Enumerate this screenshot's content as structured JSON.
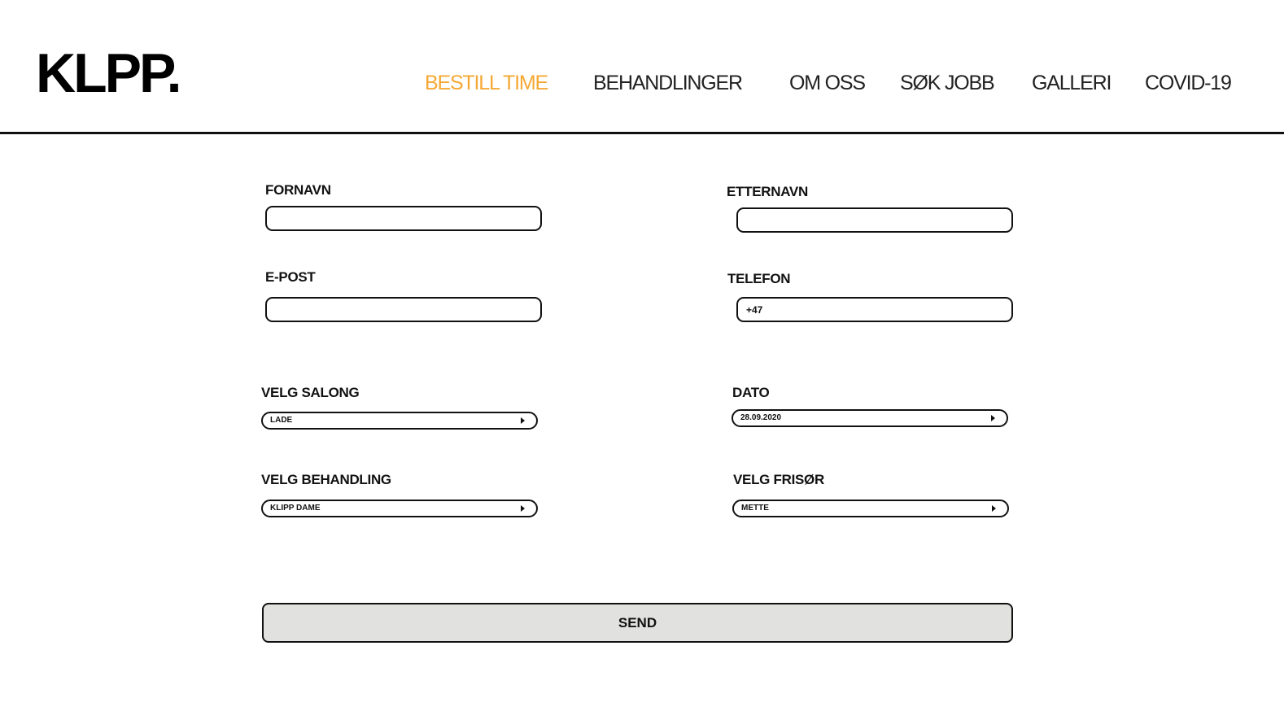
{
  "header": {
    "logo": "KLPP.",
    "nav": {
      "bestill_time": "BESTILL TIME",
      "behandlinger": "BEHANDLINGER",
      "om_oss": "OM OSS",
      "sok_jobb": "SØK JOBB",
      "galleri": "GALLERI",
      "covid": "COVID-19"
    },
    "active_color": "#F5A833"
  },
  "form": {
    "fornavn": {
      "label": "FORNAVN",
      "value": ""
    },
    "etternavn": {
      "label": "ETTERNAVN",
      "value": ""
    },
    "epost": {
      "label": "E-POST",
      "value": ""
    },
    "telefon": {
      "label": "TELEFON",
      "value": "+47"
    },
    "salong": {
      "label": "VELG SALONG",
      "value": "LADE"
    },
    "dato": {
      "label": "DATO",
      "value": "28.09.2020"
    },
    "behandling": {
      "label": "VELG BEHANDLING",
      "value": "KLIPP DAME"
    },
    "frisor": {
      "label": "VELG FRISØR",
      "value": "METTE"
    },
    "send_label": "SEND"
  }
}
